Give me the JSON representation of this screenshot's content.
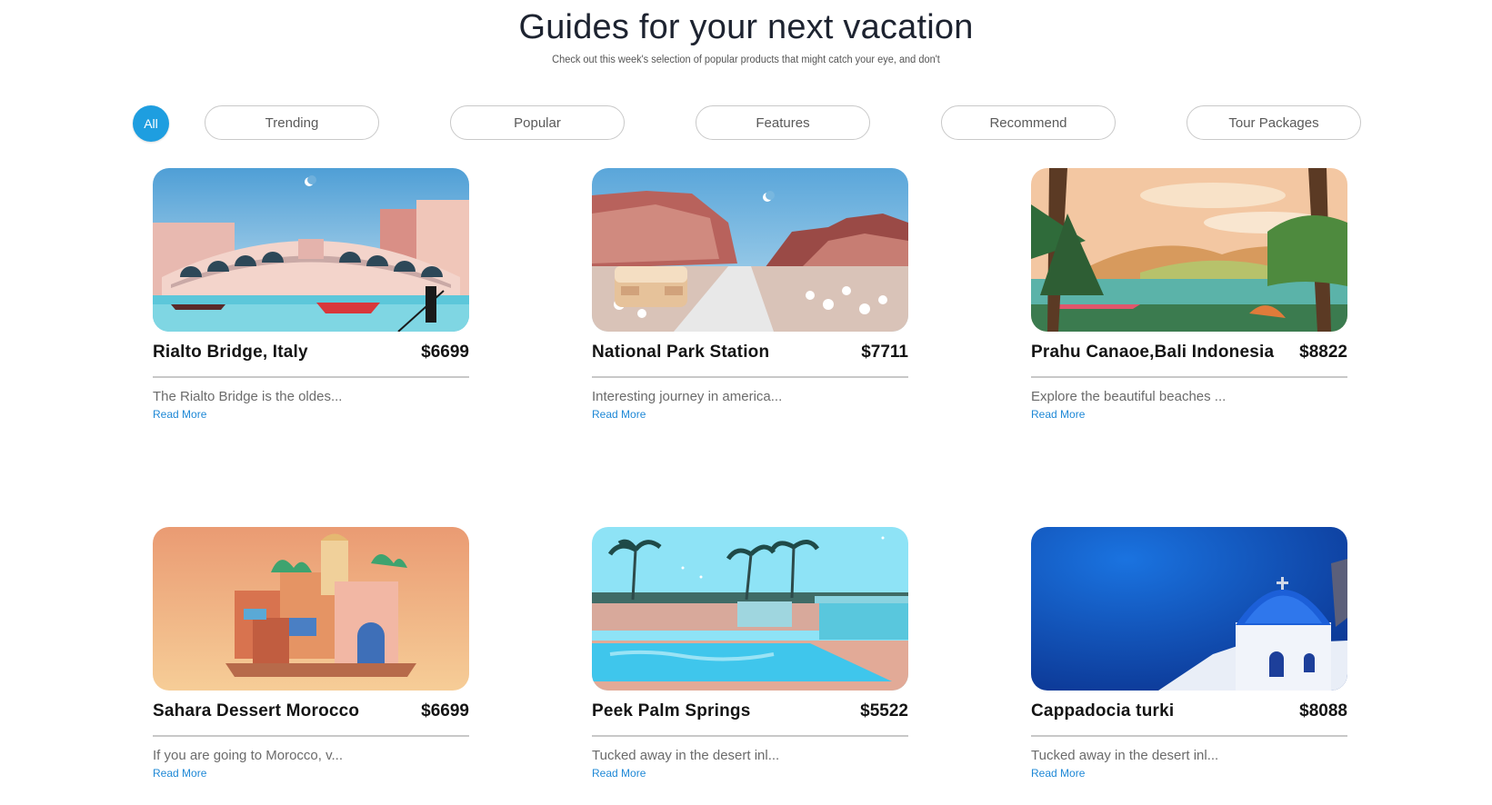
{
  "header": {
    "title": "Guides for your next vacation",
    "subtitle": "Check out this week's selection of popular products that might catch your eye, and don't"
  },
  "filters": {
    "all": "All",
    "items": [
      "Trending",
      "Popular",
      "Features",
      "Recommend",
      "Tour Packages"
    ],
    "active": "All"
  },
  "colors": {
    "accent": "#1e9ee0",
    "link": "#1e88d6"
  },
  "cards": [
    {
      "title": "Rialto Bridge, Italy",
      "price": "$6699",
      "description": "The Rialto Bridge is the oldes...",
      "link": "Read More",
      "image_icon": "venice-bridge-illustration"
    },
    {
      "title": "National Park Station",
      "price": "$7711",
      "description": "Interesting journey in america...",
      "link": "Read More",
      "image_icon": "canyon-road-van-illustration"
    },
    {
      "title": "Prahu Canaoe,Bali Indonesia",
      "price": "$8822",
      "description": "Explore the beautiful beaches ...",
      "link": "Read More",
      "image_icon": "lake-canoe-illustration"
    },
    {
      "title": "Sahara Dessert Morocco",
      "price": "$6699",
      "description": "If you are going to Morocco, v...",
      "link": "Read More",
      "image_icon": "morocco-buildings-illustration"
    },
    {
      "title": "Peek Palm Springs",
      "price": "$5522",
      "description": "Tucked away in the desert inl...",
      "link": "Read More",
      "image_icon": "palm-pool-illustration"
    },
    {
      "title": "Cappadocia turki",
      "price": "$8088",
      "description": "Tucked away in the desert inl...",
      "link": "Read More",
      "image_icon": "blue-dome-church-illustration"
    }
  ]
}
